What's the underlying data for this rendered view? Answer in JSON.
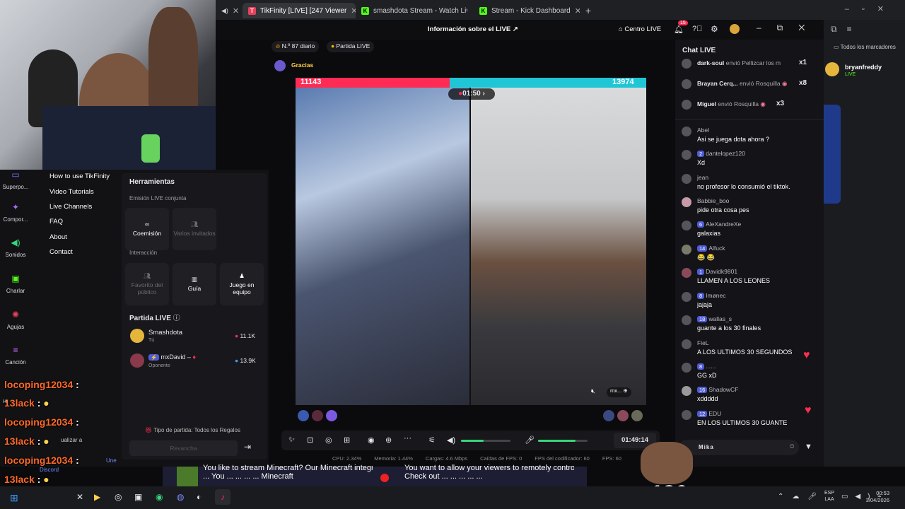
{
  "browser_tabs": [
    {
      "label": "TikFinity [LIVE] [247 Viewer",
      "active": true,
      "color": "#e8405a"
    },
    {
      "label": "smashdota Stream - Watch Live",
      "active": false,
      "color": "#53fc18"
    },
    {
      "label": "Stream - Kick Dashboard",
      "active": false,
      "color": "#53fc18"
    }
  ],
  "bookmarks_label": "Todos los marcadores",
  "kick_user": {
    "name": "bryanfreddy",
    "status": "LIVE"
  },
  "topbar": {
    "title": "Información sobre el LIVE",
    "centro": "Centro LIVE",
    "notif_count": "15"
  },
  "stats": {
    "rank": "N.º 87 diario",
    "partida": "Partida LIVE",
    "gracias": "Gracias"
  },
  "sidebar": [
    {
      "label": "Superpo...",
      "icon": "monitor-icon"
    },
    {
      "label": "Compor...",
      "icon": "sparkle-icon"
    },
    {
      "label": "Sonidos",
      "icon": "sound-icon"
    },
    {
      "label": "Charlar",
      "icon": "chat-icon"
    },
    {
      "label": "Agujas",
      "icon": "needle-icon"
    },
    {
      "label": "Canción",
      "icon": "song-icon"
    }
  ],
  "menu": [
    "How to use TikFinity",
    "Video Tutorials",
    "Live Channels",
    "FAQ",
    "About",
    "Contact"
  ],
  "tools": {
    "title": "Herramientas",
    "co_live": "Emisión LIVE conjunta",
    "coemision": "Coemisión",
    "varios": "Varios invitados",
    "interaccion": "Interacción",
    "favorito": "Favorito del público",
    "guia": "Guía",
    "juego": "Juego en equipo",
    "partida_title": "Partida LIVE",
    "player1": {
      "name": "Smashdota",
      "sub": "Tú",
      "score": "11.1K"
    },
    "player2": {
      "name": "mxDavid",
      "sub": "Oponente",
      "score": "13.9K"
    },
    "tipo": "Tipo de partida: Todos los Regalos",
    "revancha": "Revancha"
  },
  "battle": {
    "score_left": "11143",
    "score_right": "13974",
    "timer": "01:50",
    "left_ratio": 0.44
  },
  "controls": {
    "time": "01:49:14",
    "volume_level": 0.45,
    "mic_level": 0.75
  },
  "status": {
    "cpu": "CPU: 2.34%",
    "mem": "Memoria: 1.44%",
    "upload": "Cargas: 4.6 Mbps",
    "drops": "Caídas de FPS: 0",
    "enc": "FPS del codificador: 60",
    "fps": "FPS: 60"
  },
  "chat": {
    "title": "Chat LIVE",
    "gifts": [
      {
        "user": "dark-soul",
        "text": "envió Pellizcar los m",
        "mult": "x1"
      },
      {
        "user": "Brayan Cerq...",
        "text": "envió Rosquilla",
        "mult": "x8"
      },
      {
        "user": "Miguel",
        "text": "envió Rosquilla",
        "mult": "x3"
      }
    ],
    "messages": [
      {
        "badge": "",
        "user": "Abel",
        "text": "Asi se juega dota ahora ?"
      },
      {
        "badge": "2",
        "user": "dantelopez120",
        "text": "Xd"
      },
      {
        "badge": "",
        "user": "jean",
        "text": "no profesor lo consumió el tiktok."
      },
      {
        "badge": "",
        "user": "Babbie_boo",
        "text": "pide otra cosa pes"
      },
      {
        "badge": "6",
        "user": "AleXandreXe",
        "text": "galaxias"
      },
      {
        "badge": "14",
        "user": "Alfuck",
        "text": "😂 😂"
      },
      {
        "badge": "1",
        "user": "Davidk9801",
        "text": "LLAMEN A LOS LEONES"
      },
      {
        "badge": "8",
        "user": "Imønec",
        "text": "jajaja"
      },
      {
        "badge": "18",
        "user": "wallas_s",
        "text": "guante a los 30 finales"
      },
      {
        "badge": "",
        "user": "FieL",
        "text": "A LOS ULTIMOS 30 SEGUNDOS"
      },
      {
        "badge": "8",
        "user": "......",
        "text": "GG xD"
      },
      {
        "badge": "16",
        "user": "ShadowCF",
        "text": "xddddd"
      },
      {
        "badge": "12",
        "user": "EDU",
        "text": "EN LOS ULTIMOS 30 GUANTE"
      }
    ],
    "input_user": "Mika"
  },
  "overlay_chat": [
    {
      "user": "locoping12034",
      "text": ":"
    },
    {
      "user": "13lack",
      "text": ":"
    },
    {
      "user": "locoping12034",
      "text": ":"
    },
    {
      "user": "13lack",
      "text": ":"
    },
    {
      "user": "locoping12034",
      "text": ":"
    },
    {
      "user": "13lack",
      "text": ":"
    }
  ],
  "overlay_misc": {
    "actualizar": "ualizar a",
    "une": "Une",
    "discord": "Discord",
    "hi": "Hi"
  },
  "banner": {
    "left": "You like to stream Minecraft? Our Minecraft integration offers your viewers an interactive",
    "left2": "... You ... ... ... ... Minecraft",
    "right": "You want to allow your viewers to remotely control any Windows applications with gifts?",
    "right2": "Check out ... ... ... ... ..."
  },
  "combo": "x139",
  "tray": {
    "lang1": "ESP",
    "lang2": "LAA",
    "time": "00:53",
    "date": "3/04/2026"
  }
}
